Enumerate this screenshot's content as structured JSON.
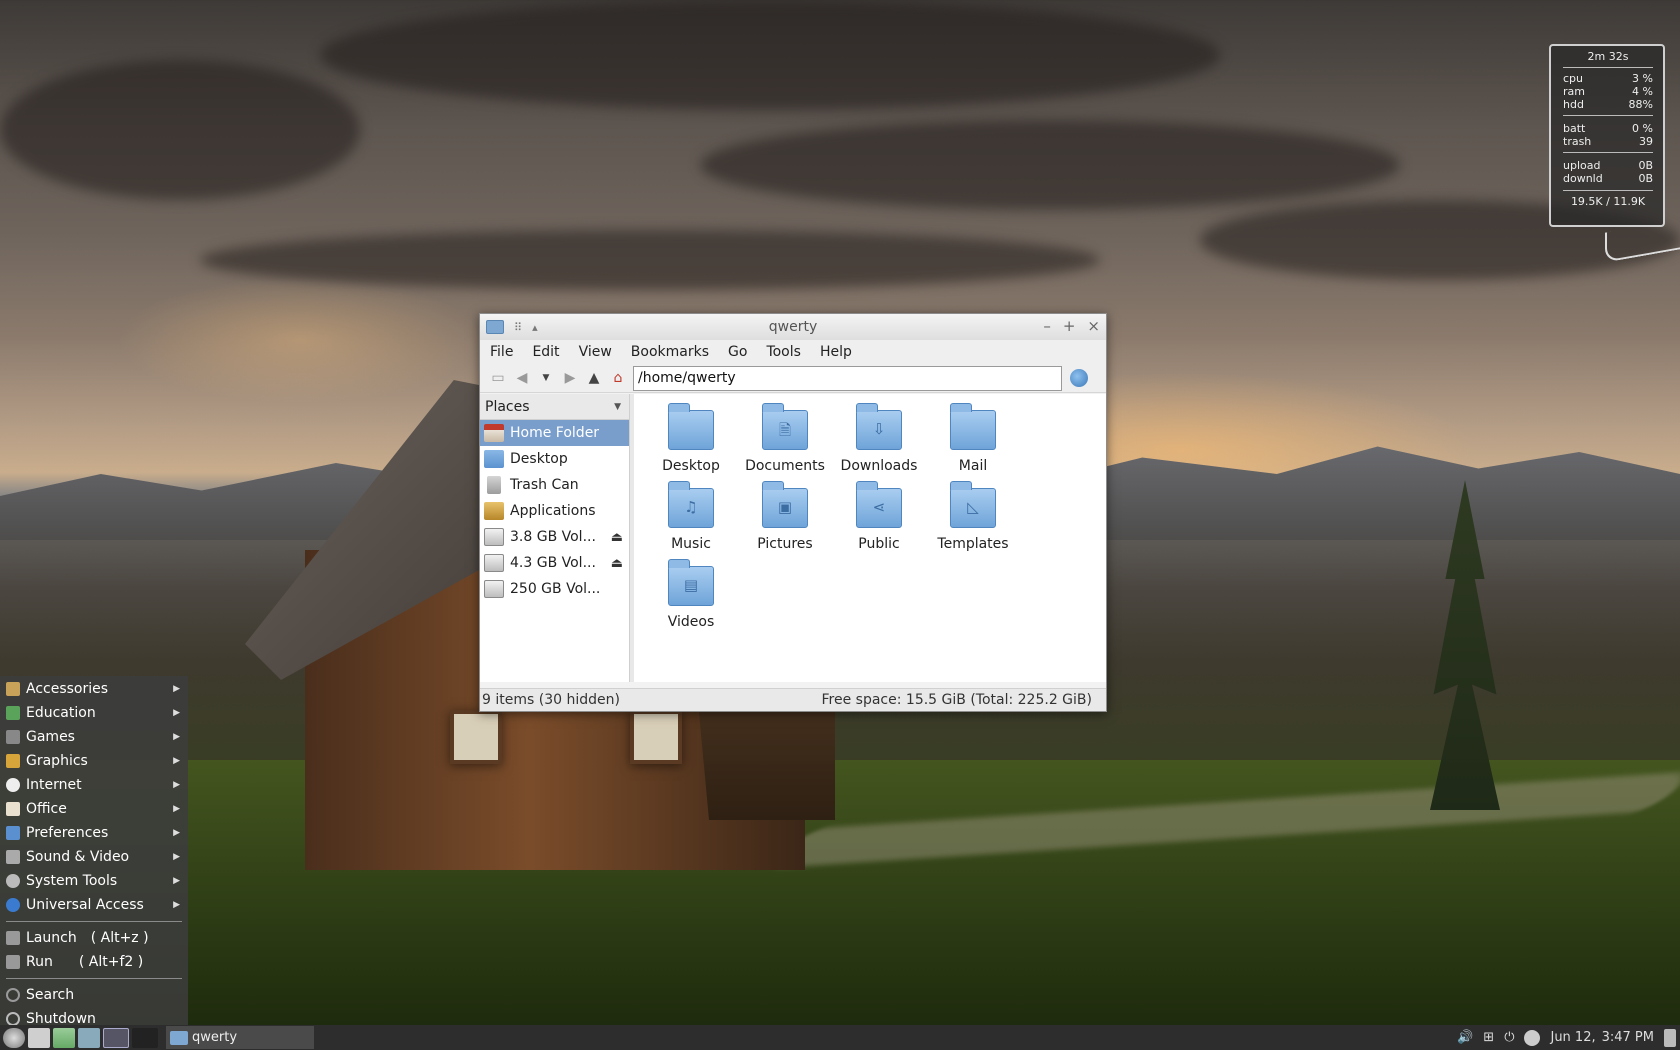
{
  "conky": {
    "uptime": "2m 32s",
    "rows": [
      {
        "label": "cpu",
        "value": "3 %"
      },
      {
        "label": "ram",
        "value": "4 %"
      },
      {
        "label": "hdd",
        "value": "88%"
      }
    ],
    "rows2": [
      {
        "label": "batt",
        "value": "0 %"
      },
      {
        "label": "trash",
        "value": "39"
      }
    ],
    "rows3": [
      {
        "label": "upload",
        "value": "0B"
      },
      {
        "label": "downld",
        "value": "0B"
      }
    ],
    "footer": "19.5K / 11.9K"
  },
  "window": {
    "title": "qwerty",
    "menu": [
      "File",
      "Edit",
      "View",
      "Bookmarks",
      "Go",
      "Tools",
      "Help"
    ],
    "location": "/home/qwerty",
    "places_header": "Places",
    "places": [
      {
        "label": "Home Folder",
        "icon": "home-icon"
      },
      {
        "label": "Desktop",
        "icon": "folder-icon"
      },
      {
        "label": "Trash Can",
        "icon": "trash-icon"
      },
      {
        "label": "Applications",
        "icon": "applications-icon"
      },
      {
        "label": "3.8 GB Vol...",
        "icon": "drive-icon"
      },
      {
        "label": "4.3 GB Vol...",
        "icon": "drive-icon"
      },
      {
        "label": "250 GB Vol...",
        "icon": "drive-icon"
      }
    ],
    "files": [
      {
        "label": "Desktop",
        "glyph": ""
      },
      {
        "label": "Documents",
        "glyph": "🗎"
      },
      {
        "label": "Downloads",
        "glyph": "⇩"
      },
      {
        "label": "Mail",
        "glyph": ""
      },
      {
        "label": "Music",
        "glyph": "♫"
      },
      {
        "label": "Pictures",
        "glyph": "▣"
      },
      {
        "label": "Public",
        "glyph": "⋖"
      },
      {
        "label": "Templates",
        "glyph": "◺"
      },
      {
        "label": "Videos",
        "glyph": "▤"
      }
    ],
    "status_left": "9 items (30 hidden)",
    "status_right": "Free space: 15.5 GiB (Total: 225.2 GiB)"
  },
  "start_menu": {
    "categories": [
      "Accessories",
      "Education",
      "Games",
      "Graphics",
      "Internet",
      "Office",
      "Preferences",
      "Sound & Video",
      "System Tools",
      "Universal Access"
    ],
    "launch": {
      "label": "Launch",
      "shortcut": "( Alt+z )"
    },
    "run": {
      "label": "Run",
      "shortcut": "( Alt+f2 )"
    },
    "search": "Search",
    "shutdown": "Shutdown"
  },
  "taskbar": {
    "task_label": "qwerty",
    "date": "Jun 12,",
    "time": "3:47 PM"
  }
}
